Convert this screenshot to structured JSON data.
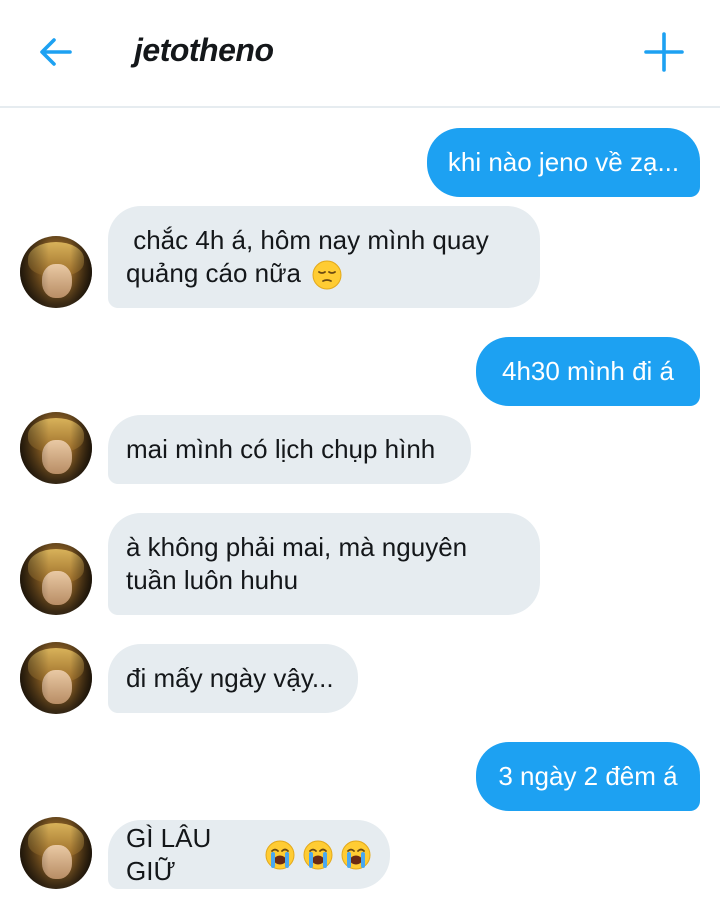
{
  "header": {
    "title": "jetotheno",
    "back_icon": "arrow-left-icon",
    "new_icon": "plus-icon",
    "accent_color": "#1da1f2"
  },
  "messages": [
    {
      "direction": "outgoing",
      "text": "khi nào jeno về zạ..."
    },
    {
      "direction": "incoming",
      "line1": " chắc 4h á, hôm nay mình quay",
      "line2": "quảng cáo nữa",
      "emoji": "pensive-face"
    },
    {
      "direction": "outgoing",
      "text": "4h30 mình đi á"
    },
    {
      "direction": "incoming",
      "text": "mai mình có lịch chụp hình"
    },
    {
      "direction": "incoming",
      "line1": "à không phải mai, mà nguyên",
      "line2": "tuần luôn huhu"
    },
    {
      "direction": "incoming",
      "text": "đi mấy ngày vậy..."
    },
    {
      "direction": "outgoing",
      "text": "3 ngày 2 đêm á"
    },
    {
      "direction": "incoming",
      "text": "GÌ LÂU GIỮ",
      "emoji": "loudly-crying-face x3"
    }
  ],
  "colors": {
    "outgoing_bubble": "#1da1f2",
    "incoming_bubble": "#e6ecf0",
    "text_dark": "#14171a"
  }
}
